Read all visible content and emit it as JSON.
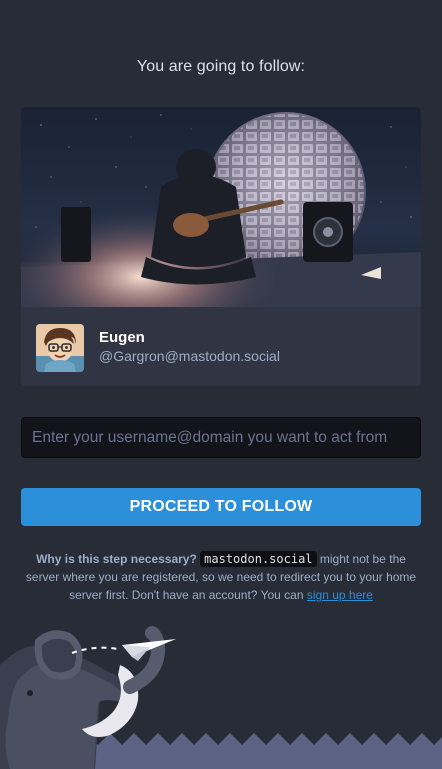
{
  "heading": "You are going to follow:",
  "account": {
    "display_name": "Eugen",
    "handle": "@Gargron@mastodon.social"
  },
  "form": {
    "acct_placeholder": "Enter your username@domain you want to act from",
    "acct_value": "",
    "proceed_label": "PROCEED TO FOLLOW"
  },
  "hint": {
    "prefix": "Why is this step necessary?",
    "domain": "mastodon.social",
    "body": " might not be the server where you are registered, so we need to redirect you to your home server first. Don't have an account? You can ",
    "signup_link": "sign up here"
  },
  "colors": {
    "background": "#282c37",
    "card": "#313543",
    "accent": "#2b90d9",
    "input_background": "#131419",
    "muted_text": "#9baec8"
  },
  "icons": {
    "avatar": "cartoon-avatar",
    "mascot": "elephant-with-paper-plane"
  }
}
